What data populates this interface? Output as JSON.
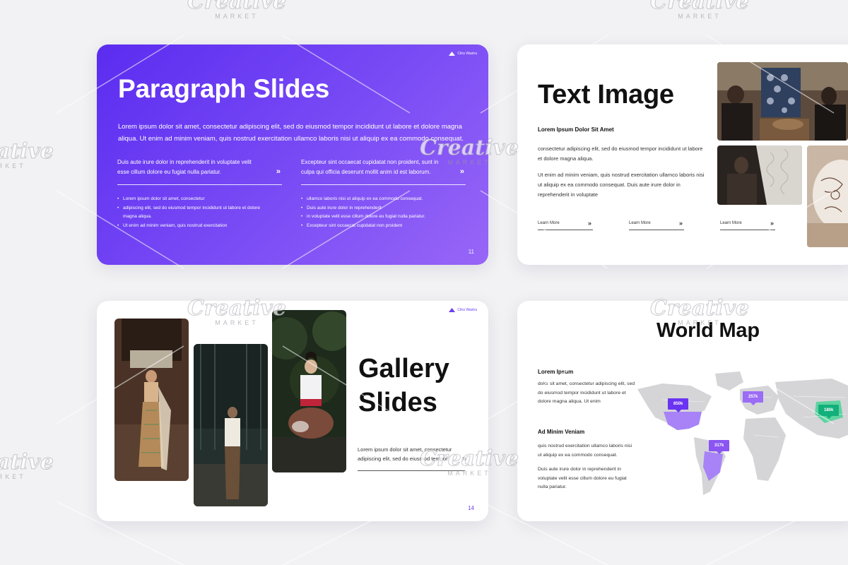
{
  "slides": {
    "s1": {
      "brand": "Citra Wastra",
      "title": "Paragraph Slides",
      "intro": "Lorem ipsum dolor sit amet, consectetur adipiscing elit, sed do eiusmod tempor incididunt ut labore et dolore magna aliqua. Ut enim ad minim veniam, quis nostrud exercitation ullamco laboris nisi ut aliquip ex ea commodo consequat.",
      "col1_text": "Duis aute irure dolor in reprehenderit in voluptate velit esse cillum dolore eu fugiat nulla pariatur.",
      "col2_text": "Excepteur sint occaecat cupidatat non proident, sunt in culpa qui officia deserunt mollit anim id est laborum.",
      "col1_bullets": [
        "Lorem ipsum dolor sit amet, consectetur",
        "adipiscing elit, sed do eiusmod tempor incididunt ut labore et dolore magna aliqua.",
        "Ut enim ad minim veniam, quis nostrud exercitation"
      ],
      "col2_bullets": [
        "ullamco laboris nisi ut aliquip ex ea commodo consequat.",
        "Duis aute irure dolor in reprehenderit",
        "in voluptate velit esse cillum dolore eu fugiat nulla pariatur.",
        "Excepteur sint occaecat cupidatat non proident"
      ],
      "arrow": "»",
      "page": "11"
    },
    "s2": {
      "title": "Text Image",
      "subtitle": "Lorem Ipsum Dolor Sit Amet",
      "para1": "consectetur adipiscing elit, sed do eiusmod tempor incididunt ut labore et dolore magna aliqua.",
      "para2": "Ut enim ad minim veniam, quis nostrud exercitation ullamco laboris nisi ut aliquip ex ea commodo consequat. Duis aute irure dolor in reprehenderit in voluptate",
      "learn_more": [
        "Learn More",
        "Learn More",
        "Learn More"
      ],
      "arrow": "»"
    },
    "s3": {
      "brand": "Citra Wastra",
      "title_line1": "Gallery",
      "title_line2": "Slides",
      "desc": "Lorem ipsum dolor sit amet, consectetur adipiscing elit, sed do eiusmod tempor",
      "arrow": "»",
      "page": "14"
    },
    "s4": {
      "title": "World Map",
      "h1": "Lorem Ipsum",
      "t1": "dolor sit amet, consectetur adipiscing elit, sed do eiusmod tempor incididunt ut labore et dolore magna aliqua. Ut enim",
      "h2": "Ad Minim Veniam",
      "t2": "quis nostrud exercitation ullamco laboris nisi ut aliquip ex ea commodo consequat.",
      "t3": "Duis aute irure dolor in reprehenderit in voluptate velit esse cillum dolore eu fugiat nulla pariatur.",
      "pins": [
        {
          "label": "850k",
          "color": "#6a33f1"
        },
        {
          "label": "257k",
          "color": "#9b6cf5"
        },
        {
          "label": "317k",
          "color": "#8a55f3"
        },
        {
          "label": "180k",
          "color": "#12b07a"
        }
      ]
    }
  },
  "watermark": {
    "word": "Creative",
    "sub": "MARKET"
  },
  "colors": {
    "accent": "#6b3ff2",
    "background": "#f2f2f4",
    "map_gray": "#d5d5d8",
    "map_purple": "#a783f7"
  }
}
